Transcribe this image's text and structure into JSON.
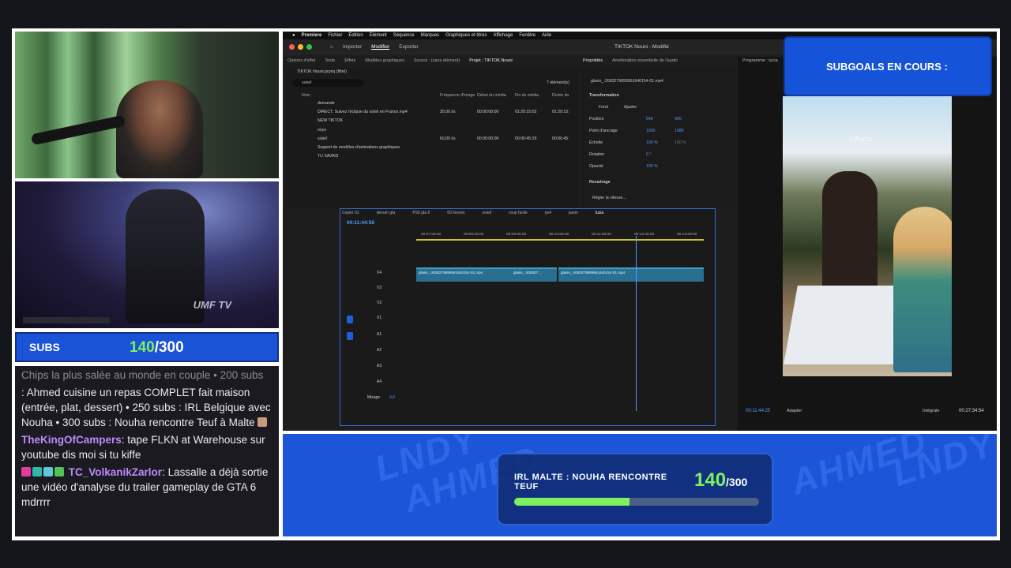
{
  "subs_widget": {
    "label": "SUBS",
    "current": "140",
    "goal": "/300"
  },
  "chat": {
    "messages": [
      {
        "text": "Chips la plus salée au monde en couple • 200 subs",
        "faded": true
      },
      {
        "text": ": Ahmed cuisine un repas COMPLET fait maison (entrée, plat, dessert) • 250 subs : IRL Belgique avec Nouha • 300 subs : Nouha rencontre Teuf à Malte"
      },
      {
        "user": "TheKingOfCampers",
        "text": ": tape FLKN at Warehouse sur youtube dis moi si tu kiffe"
      },
      {
        "user": "TC_VolkanikZarlor",
        "text": ": Lassalle a déjà sortie une vidéo d'analyse du trailer gameplay de GTA 6 mdrrrr"
      }
    ]
  },
  "premiere": {
    "menu": [
      "Premiere",
      "Fichier",
      "Édition",
      "Élément",
      "Séquence",
      "Marques",
      "Graphiques et titres",
      "Affichage",
      "Fenêtre",
      "Aide"
    ],
    "nav": [
      "Importer",
      "Modifier",
      "Exporter"
    ],
    "title": "TIKTOK Nouni - Modifié",
    "left_tabs": [
      "Options d'effet",
      "Texte",
      "Effets",
      "Modèles graphiques",
      "Source : (sans élément)",
      "Projet : TIKTOK Nouni"
    ],
    "project_file": "TIKTOK Nouni.prproj (filtré)",
    "search_value": "soleil",
    "item_count": "7 élément(s)",
    "columns": [
      "Nom",
      "Fréquence d'image",
      "Début du média",
      "Fin du média",
      "Durée du"
    ],
    "items": [
      {
        "name": "demande",
        "fps": "",
        "start": "",
        "end": "",
        "dur": ""
      },
      {
        "name": "DIRECT. Suivez l'éclipse du soleil en France.mp4",
        "fps": "30,00 i/s",
        "start": "00:00:00:00",
        "end": "01:20:15:02",
        "dur": "01:20:15:"
      },
      {
        "name": "NEW TIKTOK",
        "fps": "",
        "start": "",
        "end": "",
        "dur": ""
      },
      {
        "name": "onyx",
        "fps": "",
        "start": "",
        "end": "",
        "dur": ""
      },
      {
        "name": "soleil",
        "fps": "60,00 i/s",
        "start": "00:00:00:00",
        "end": "00:00:45:29",
        "dur": "00:00:45:"
      },
      {
        "name": "Support de modèles d'animations graphiques",
        "fps": "",
        "start": "",
        "end": "",
        "dur": ""
      },
      {
        "name": "TU SAVAIS",
        "fps": "",
        "start": "",
        "end": "",
        "dur": ""
      }
    ],
    "props_tabs": [
      "Propriétés",
      "Amélioration essentielle de l'audio"
    ],
    "props_clip": "glasix_-2093279899561640154-01.mp4",
    "props": {
      "section": "Transformation",
      "fond": "Fond",
      "ajuster": "Ajuster",
      "position_label": "Position",
      "position_x": "540",
      "position_y": "960",
      "anchor_label": "Point d'ancrage",
      "anchor_x": "1920",
      "anchor_y": "1080",
      "scale_label": "Échelle",
      "scale": "100 %",
      "scale2": "100 %",
      "rotation_label": "Rotation",
      "rotation": "0 °",
      "opacity_label": "Opacité",
      "opacity": "100 %",
      "crop_section": "Recadrage",
      "speed": "Régler la vitesse..."
    },
    "timeline": {
      "tabs": [
        "Copier 01",
        "dervah gta",
        "PS5 gta 6",
        "60 heures",
        "soleil",
        "coup facile",
        "ps4",
        "jason",
        "lucia"
      ],
      "timecode": "00:11:44:56",
      "ruler": [
        "00:07:00:00",
        "00:08:00:00",
        "00:09:00:00",
        "00:10:00:00",
        "00:11:00:00",
        "00:12:00:00",
        "00:13:00:00"
      ],
      "tracks": [
        "V4",
        "V3",
        "V2",
        "V1",
        "A1",
        "A2",
        "A3",
        "A4"
      ],
      "mix_label": "Mixage",
      "mix_value": "0,0",
      "clips": [
        "glasix_-2093279899561640154-01.mp4",
        "glasix_-209327...",
        "glasix_-2093279899561640154-01.mp4"
      ]
    },
    "program": {
      "label": "Programme : lucia",
      "sign": "Ufuria",
      "timecode": "00:11:44:25",
      "fit": "Adapter",
      "quality": "Intégrale",
      "duration": "00:27:34:54"
    }
  },
  "subgoals": {
    "title": "SUBGOALS EN COURS :"
  },
  "goal_banner": {
    "title": "IRL MALTE : NOUHA RENCONTRE TEUF",
    "current": "140",
    "total": "/300",
    "progress": 0.47,
    "watermarks": [
      "AHMED",
      "LNDY",
      "AHMED",
      "LNDY"
    ]
  },
  "colors": {
    "accent_blue": "#1d55d9",
    "progress_green": "#7ff060",
    "premiere_blue": "#4f9dff"
  },
  "video_feed": {
    "logo": "UMF TV"
  }
}
